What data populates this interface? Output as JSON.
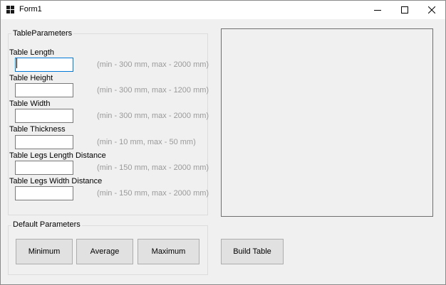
{
  "window": {
    "title": "Form1",
    "icon": "form-app-icon",
    "controls": [
      "minimize-icon",
      "maximize-icon",
      "close-icon"
    ]
  },
  "table_parameters": {
    "caption": "TableParameters",
    "fields": [
      {
        "label": "Table Length",
        "value": "",
        "hint": "(min - 300 mm, max - 2000 mm)",
        "focused": true
      },
      {
        "label": "Table Height",
        "value": "",
        "hint": "(min - 300 mm, max - 1200 mm)",
        "focused": false
      },
      {
        "label": "Table Width",
        "value": "",
        "hint": "(min - 300 mm, max - 2000 mm)",
        "focused": false
      },
      {
        "label": "Table Thickness",
        "value": "",
        "hint": "(min - 10 mm, max - 50 mm)",
        "focused": false
      },
      {
        "label": "Table Legs Length Distance",
        "value": "",
        "hint": "(min - 150 mm, max - 2000 mm)",
        "focused": false
      },
      {
        "label": "Table Legs Width Distance",
        "value": "",
        "hint": "(min - 150 mm, max - 2000 mm)",
        "focused": false
      }
    ]
  },
  "default_parameters": {
    "caption": "Default Parameters",
    "buttons": [
      "Minimum",
      "Average",
      "Maximum"
    ]
  },
  "build_button": "Build Table",
  "colors": {
    "focus_border": "#0078d7",
    "hint_text": "#9a9a9a",
    "button_face": "#e1e1e1",
    "form_background": "#f0f0f0"
  }
}
